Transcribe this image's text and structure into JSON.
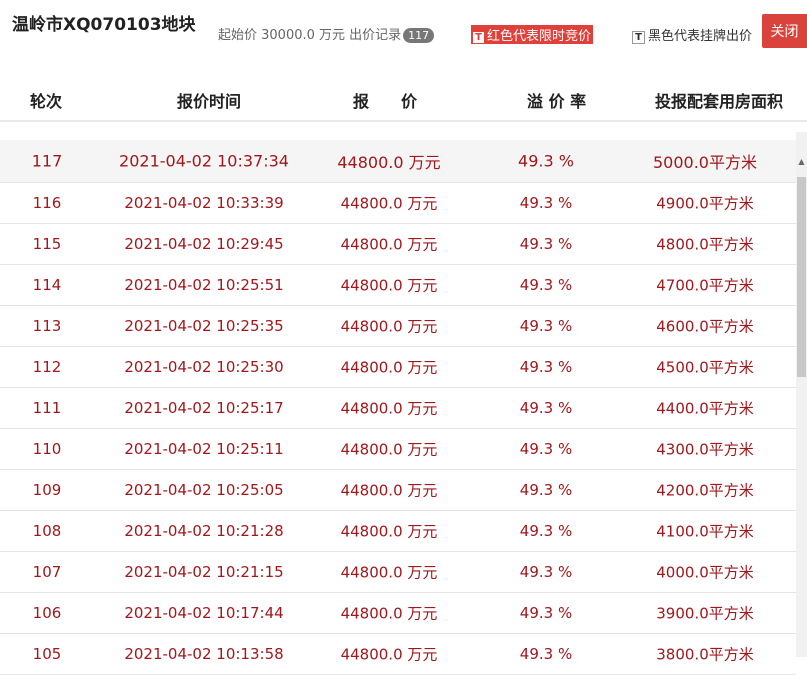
{
  "header": {
    "title": "温岭市XQ070103地块",
    "start_price_label": "起始价 30000.0 万元  出价记录",
    "bid_count": "117",
    "legend_red": "红色代表限时竞价",
    "legend_black": "黑色代表挂牌出价",
    "close_label": "关闭"
  },
  "table": {
    "columns": [
      "轮次",
      "报价时间",
      "报　　价",
      "溢 价 率",
      "投报配套用房面积"
    ],
    "rows": [
      {
        "round": "117",
        "time": "2021-04-02 10:37:34",
        "price": "44800.0 万元",
        "rate": "49.3 %",
        "area": "5000.0平方米"
      },
      {
        "round": "116",
        "time": "2021-04-02 10:33:39",
        "price": "44800.0 万元",
        "rate": "49.3 %",
        "area": "4900.0平方米"
      },
      {
        "round": "115",
        "time": "2021-04-02 10:29:45",
        "price": "44800.0 万元",
        "rate": "49.3 %",
        "area": "4800.0平方米"
      },
      {
        "round": "114",
        "time": "2021-04-02 10:25:51",
        "price": "44800.0 万元",
        "rate": "49.3 %",
        "area": "4700.0平方米"
      },
      {
        "round": "113",
        "time": "2021-04-02 10:25:35",
        "price": "44800.0 万元",
        "rate": "49.3 %",
        "area": "4600.0平方米"
      },
      {
        "round": "112",
        "time": "2021-04-02 10:25:30",
        "price": "44800.0 万元",
        "rate": "49.3 %",
        "area": "4500.0平方米"
      },
      {
        "round": "111",
        "time": "2021-04-02 10:25:17",
        "price": "44800.0 万元",
        "rate": "49.3 %",
        "area": "4400.0平方米"
      },
      {
        "round": "110",
        "time": "2021-04-02 10:25:11",
        "price": "44800.0 万元",
        "rate": "49.3 %",
        "area": "4300.0平方米"
      },
      {
        "round": "109",
        "time": "2021-04-02 10:25:05",
        "price": "44800.0 万元",
        "rate": "49.3 %",
        "area": "4200.0平方米"
      },
      {
        "round": "108",
        "time": "2021-04-02 10:21:28",
        "price": "44800.0 万元",
        "rate": "49.3 %",
        "area": "4100.0平方米"
      },
      {
        "round": "107",
        "time": "2021-04-02 10:21:15",
        "price": "44800.0 万元",
        "rate": "49.3 %",
        "area": "4000.0平方米"
      },
      {
        "round": "106",
        "time": "2021-04-02 10:17:44",
        "price": "44800.0 万元",
        "rate": "49.3 %",
        "area": "3900.0平方米"
      },
      {
        "round": "105",
        "time": "2021-04-02 10:13:58",
        "price": "44800.0 万元",
        "rate": "49.3 %",
        "area": "3800.0平方米"
      }
    ]
  },
  "colors": {
    "accent_red": "#d9433b",
    "row_text": "#a0181c"
  }
}
